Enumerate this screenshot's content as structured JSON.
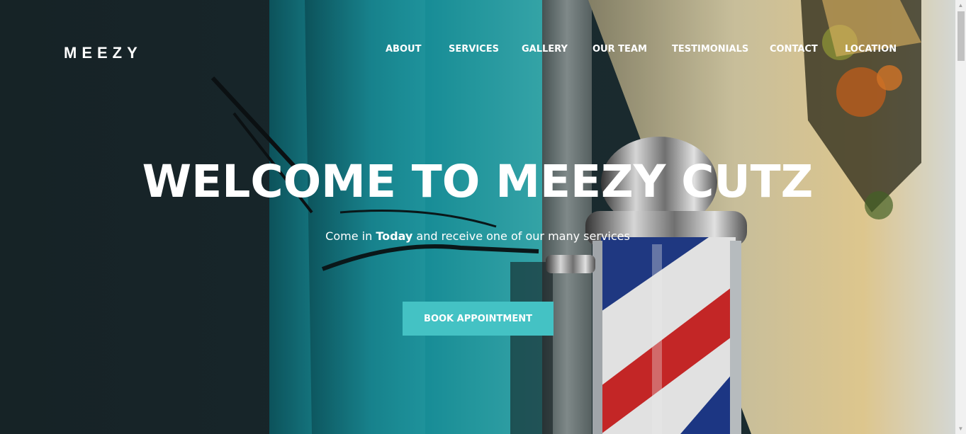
{
  "brand": {
    "logo": "MEEZY"
  },
  "nav": {
    "items": [
      {
        "label": "ABOUT"
      },
      {
        "label": "SERVICES"
      },
      {
        "label": "GALLERY"
      },
      {
        "label": "OUR TEAM"
      },
      {
        "label": "TESTIMONIALS"
      },
      {
        "label": "CONTACT"
      },
      {
        "label": "LOCATION"
      }
    ]
  },
  "hero": {
    "title": "WELCOME TO MEEZY CUTZ",
    "subtitle_pre": "Come in ",
    "subtitle_bold": "Today",
    "subtitle_post": " and receive one of our many services",
    "cta_label": "BOOK APPOINTMENT"
  },
  "colors": {
    "accent": "#44c2c4",
    "text": "#ffffff",
    "dark": "#1d2a2e"
  }
}
